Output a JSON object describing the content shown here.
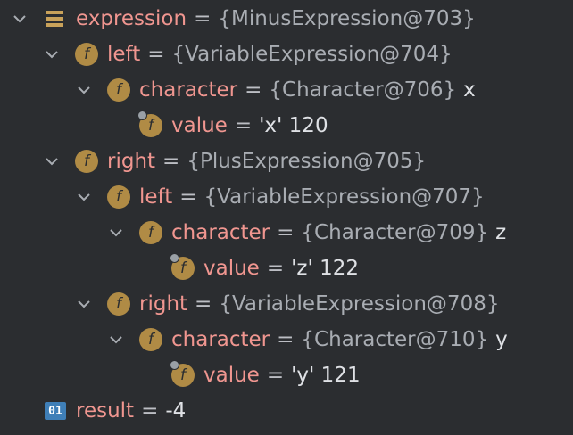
{
  "rows": [
    {
      "name": "expression",
      "eq": "=",
      "value": "{MinusExpression@703}",
      "extra": ""
    },
    {
      "name": "left",
      "eq": "=",
      "value": "{VariableExpression@704}",
      "extra": ""
    },
    {
      "name": "character",
      "eq": "=",
      "value": "{Character@706}",
      "extra": "x"
    },
    {
      "name": "value",
      "eq": "=",
      "value": "'x' 120",
      "extra": ""
    },
    {
      "name": "right",
      "eq": "=",
      "value": "{PlusExpression@705}",
      "extra": ""
    },
    {
      "name": "left",
      "eq": "=",
      "value": "{VariableExpression@707}",
      "extra": ""
    },
    {
      "name": "character",
      "eq": "=",
      "value": "{Character@709}",
      "extra": "z"
    },
    {
      "name": "value",
      "eq": "=",
      "value": "'z' 122",
      "extra": ""
    },
    {
      "name": "right",
      "eq": "=",
      "value": "{VariableExpression@708}",
      "extra": ""
    },
    {
      "name": "character",
      "eq": "=",
      "value": "{Character@710}",
      "extra": "y"
    },
    {
      "name": "value",
      "eq": "=",
      "value": "'y' 121",
      "extra": ""
    },
    {
      "name": "result",
      "eq": "=",
      "value": "-4",
      "extra": ""
    }
  ],
  "icons": {
    "field": "f",
    "primitive": "01"
  }
}
